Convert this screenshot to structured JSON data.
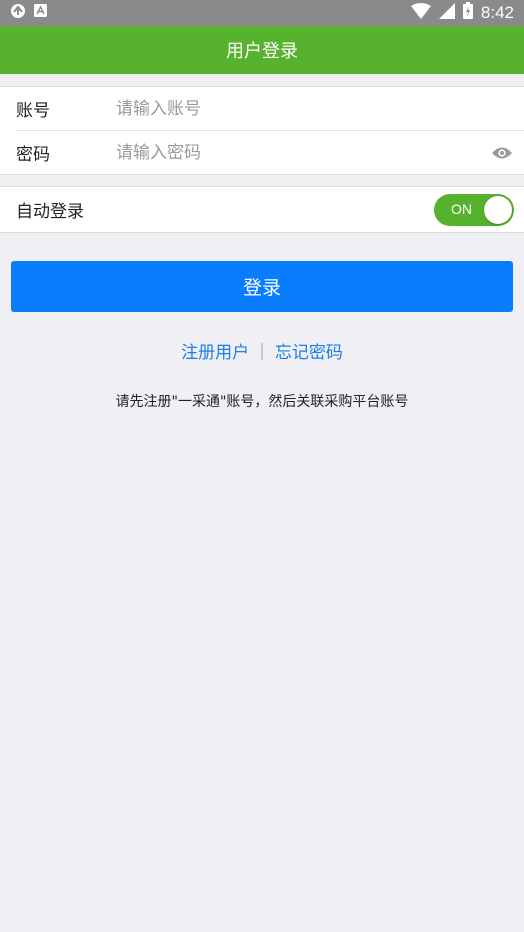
{
  "status_bar": {
    "time": "8:42"
  },
  "title": "用户登录",
  "form": {
    "account_label": "账号",
    "account_placeholder": "请输入账号",
    "password_label": "密码",
    "password_placeholder": "请输入密码"
  },
  "auto_login": {
    "label": "自动登录",
    "toggle_text": "ON",
    "enabled": true
  },
  "login_button": "登录",
  "links": {
    "register": "注册用户",
    "separator": "|",
    "forgot": "忘记密码"
  },
  "note": "请先注册\"一采通\"账号，然后关联采购平台账号",
  "colors": {
    "header": "#57b22d",
    "primary": "#0a7dff",
    "link": "#1a7fe8",
    "toggle_on": "#56b22c"
  }
}
